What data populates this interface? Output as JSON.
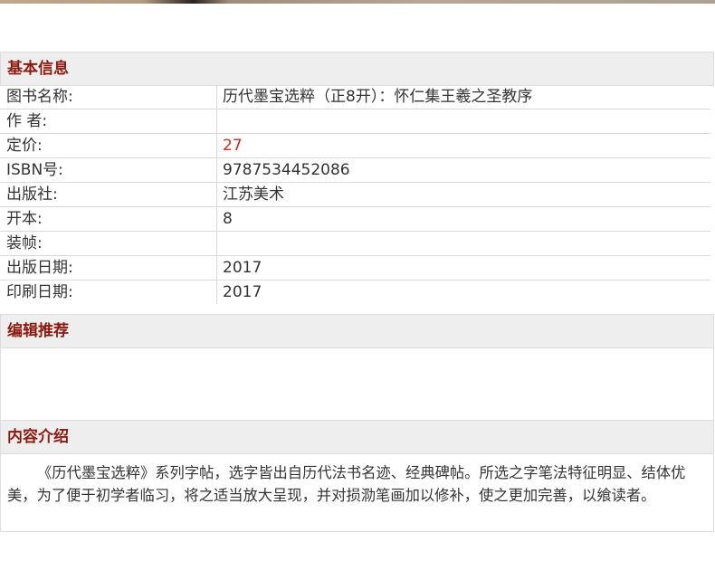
{
  "sections": {
    "basic_title": "基本信息",
    "editor_title": "编辑推荐",
    "intro_title": "内容介绍"
  },
  "info": [
    {
      "label": "图书名称:",
      "value": "历代墨宝选粹（正8开）：怀仁集王羲之圣教序"
    },
    {
      "label": "作 者:",
      "value": ""
    },
    {
      "label": "定价:",
      "value": "27"
    },
    {
      "label": "ISBN号:",
      "value": "9787534452086"
    },
    {
      "label": "出版社:",
      "value": "江苏美术"
    },
    {
      "label": "开本:",
      "value": "8"
    },
    {
      "label": "装帧:",
      "value": ""
    },
    {
      "label": "出版日期:",
      "value": "2017"
    },
    {
      "label": "印刷日期:",
      "value": "2017"
    }
  ],
  "editor_recommendation": "",
  "intro_text": "《历代墨宝选粹》系列字帖，选字皆出自历代法书名迹、经典碑帖。所选之字笔法特征明显、结体优美，为了便于初学者临习，将之适当放大呈现，并对损泐笔画加以修补，使之更加完善，以飨读者。",
  "colors": {
    "header_text": "#8b1a10",
    "header_bg": "#eeeeee",
    "price": "#cc2a1a",
    "border": "#dddddd"
  }
}
